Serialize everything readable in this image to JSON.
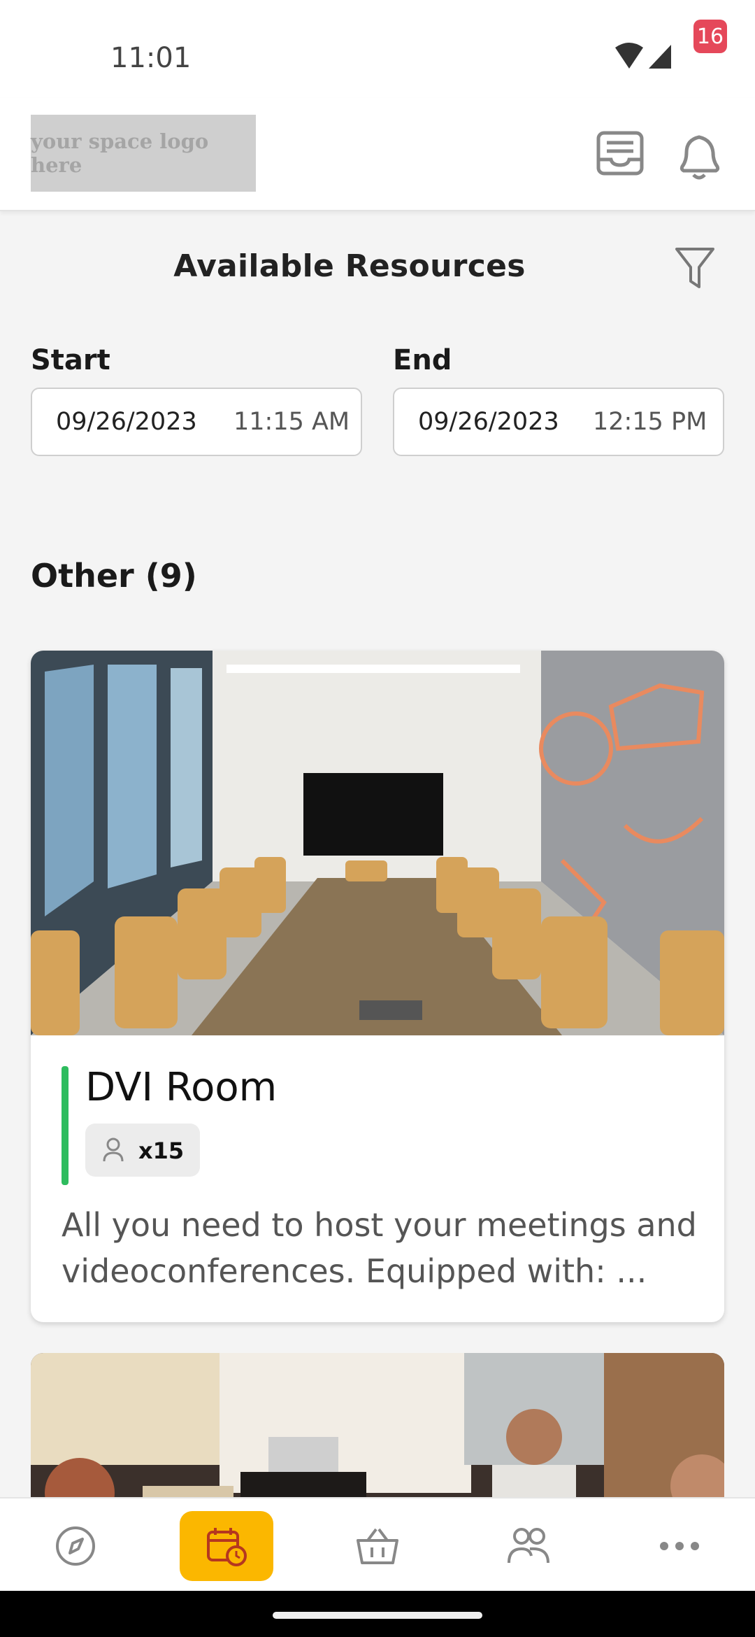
{
  "status_bar": {
    "time": "11:01"
  },
  "header": {
    "logo_text": "your space logo here",
    "notification_count": "16"
  },
  "page": {
    "title": "Available Resources"
  },
  "dates": {
    "start_label": "Start",
    "start_date": "09/26/2023",
    "start_time": "11:15 AM",
    "end_label": "End",
    "end_date": "09/26/2023",
    "end_time": "12:15 PM"
  },
  "section": {
    "title": "Other (9)"
  },
  "resources": [
    {
      "name": "DVI Room",
      "capacity": "x15",
      "description": "All you need to host your meetings and videoconferences. Equipped with: ...",
      "accent_color": "#2ebc5e"
    }
  ],
  "nav": {
    "items": [
      "explore-icon",
      "calendar-clock-icon",
      "basket-icon",
      "people-icon",
      "more-icon"
    ],
    "active_index": 1,
    "accent_color": "#fbb700"
  }
}
